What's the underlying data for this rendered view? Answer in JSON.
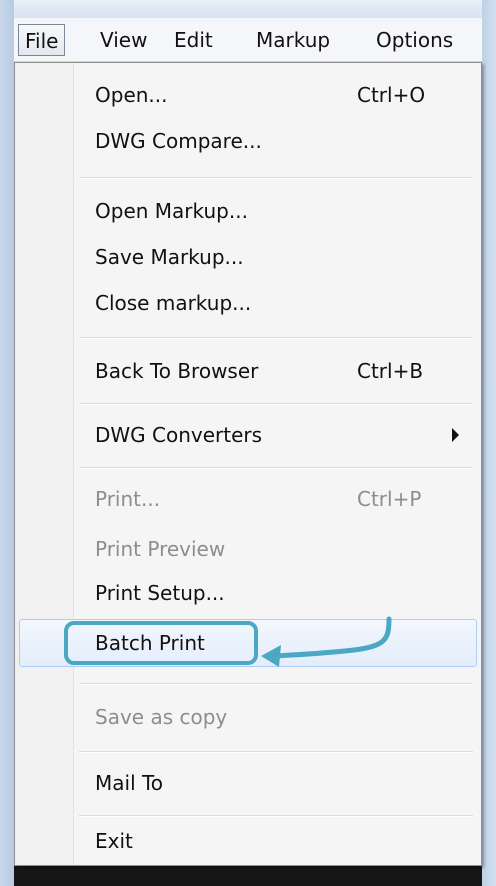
{
  "menubar": {
    "items": [
      "File",
      "View",
      "Edit",
      "Markup",
      "Options"
    ]
  },
  "file_menu": {
    "open": {
      "label": "Open...",
      "shortcut": "Ctrl+O"
    },
    "dwg_compare": {
      "label": "DWG Compare..."
    },
    "open_markup": {
      "label": "Open Markup..."
    },
    "save_markup": {
      "label": "Save Markup..."
    },
    "close_markup": {
      "label": "Close markup..."
    },
    "back_to_browser": {
      "label": "Back To Browser",
      "shortcut": "Ctrl+B"
    },
    "dwg_converters": {
      "label": "DWG Converters"
    },
    "print": {
      "label": "Print...",
      "shortcut": "Ctrl+P",
      "enabled": false
    },
    "print_preview": {
      "label": "Print Preview",
      "enabled": false
    },
    "print_setup": {
      "label": "Print Setup..."
    },
    "batch_print": {
      "label": "Batch Print",
      "highlighted": true
    },
    "save_as_copy": {
      "label": "Save as copy",
      "enabled": false
    },
    "mail_to": {
      "label": "Mail To"
    },
    "exit": {
      "label": "Exit"
    }
  },
  "colors": {
    "callout": "#4aa8c4",
    "highlight_border": "#aecdf4",
    "disabled_text": "#8d8d8d"
  }
}
